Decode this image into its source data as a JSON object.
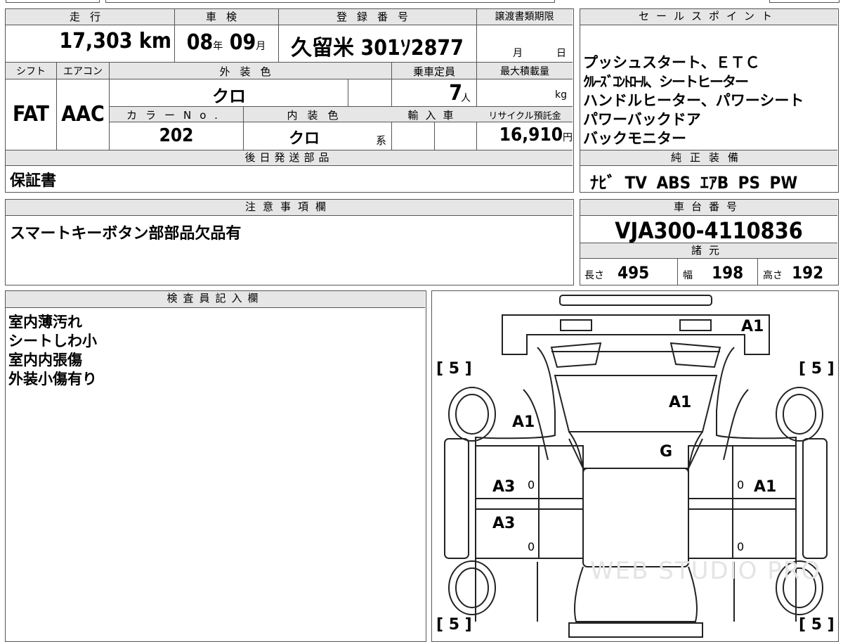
{
  "top_row": {
    "mileage": {
      "label": "走行",
      "value": "17,303",
      "unit": "km"
    },
    "inspection": {
      "label": "車検",
      "year": "08",
      "year_unit": "年",
      "month": "09",
      "month_unit": "月"
    },
    "registration": {
      "label": "登録番号",
      "value": "久留米 301ｿ2877"
    },
    "transfer_deadline": {
      "label": "譲渡書類期限",
      "month_unit": "月",
      "day_unit": "日"
    }
  },
  "second_row": {
    "shift": {
      "label": "シフト",
      "value": "FAT"
    },
    "aircon": {
      "label": "エアコン",
      "value": "AAC"
    },
    "exterior_color": {
      "label": "外装色",
      "value": "クロ"
    },
    "capacity": {
      "label": "乗車定員",
      "value": "7",
      "unit": "人"
    },
    "max_load": {
      "label": "最大積載量",
      "unit": "kg"
    },
    "color_no": {
      "label": "カラーNo.",
      "value": "202"
    },
    "interior_color": {
      "label": "内装色",
      "value": "クロ",
      "unit": "系"
    },
    "import": {
      "label": "輸入車"
    },
    "recycle_fee": {
      "label": "リサイクル預託金",
      "value": "16,910",
      "unit": "円"
    }
  },
  "sales_points": {
    "label": "セールスポイント",
    "lines": [
      "プッシュスタート、ＥＴＣ",
      "ｸﾙｰｽﾞｺﾝﾄﾛｰﾙ、シートヒーター",
      "ハンドルヒーター、パワーシート",
      "パワーバックドア",
      "バックモニター"
    ]
  },
  "later_parts": {
    "label": "後日発送部品",
    "value": "保証書"
  },
  "genuine_equipment": {
    "label": "純正装備",
    "value": "ﾅﾋﾞ TV ABS ｴｱB PS PW"
  },
  "notes": {
    "label": "注意事項欄",
    "value": "スマートキーボタン部部品欠品有"
  },
  "chassis_no": {
    "label": "車台番号",
    "value": "VJA300-4110836"
  },
  "specs": {
    "label": "諸元",
    "length_label": "長さ",
    "length": "495",
    "width_label": "幅",
    "width": "198",
    "height_label": "高さ",
    "height": "192"
  },
  "inspector": {
    "label": "検査員記入欄",
    "lines": [
      "室内薄汚れ",
      "シートしわ小",
      "室内内張傷",
      "外装小傷有り"
    ]
  },
  "diagram": {
    "marks": [
      "A1",
      "A1",
      "A1",
      "G",
      "A3",
      "A3",
      "A1"
    ],
    "tires": [
      "[ 5 ]",
      "[ 5 ]",
      "[ 5 ]",
      "[ 5 ]"
    ],
    "zeros": [
      "0",
      "0",
      "0",
      "0"
    ],
    "watermark": "WEB STUDIO PRO"
  }
}
